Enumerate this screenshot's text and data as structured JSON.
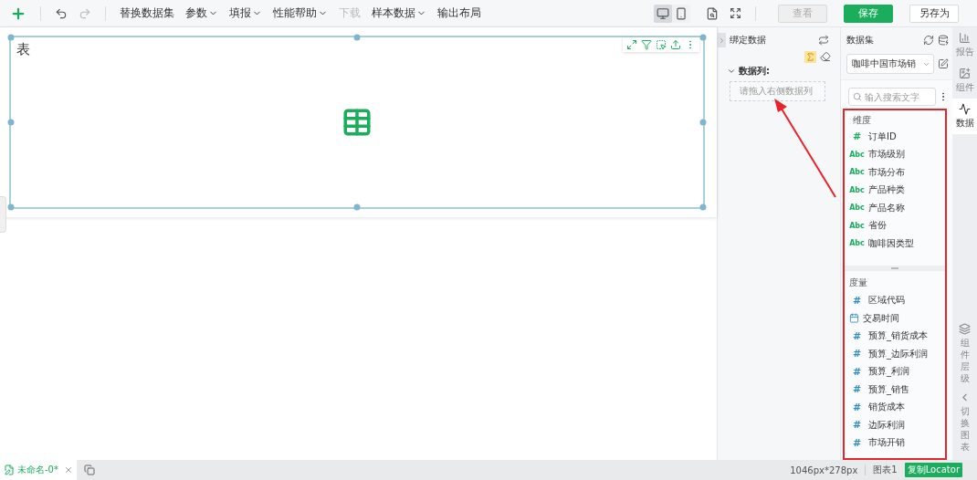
{
  "toolbar": {
    "menus": [
      {
        "label": "替换数据集",
        "dropdown": false,
        "disabled": false
      },
      {
        "label": "参数",
        "dropdown": true,
        "disabled": false
      },
      {
        "label": "填报",
        "dropdown": true,
        "disabled": false
      },
      {
        "label": "性能帮助",
        "dropdown": true,
        "disabled": false
      },
      {
        "label": "下载",
        "dropdown": false,
        "disabled": true
      },
      {
        "label": "样本数据",
        "dropdown": true,
        "disabled": false
      },
      {
        "label": "输出布局",
        "dropdown": false,
        "disabled": false
      }
    ],
    "view_modes": [
      {
        "kind": "desktop",
        "selected": true
      },
      {
        "kind": "mobile",
        "selected": false
      }
    ],
    "buttons": [
      {
        "label": "查看",
        "kind": "disabled"
      },
      {
        "label": "保存",
        "kind": "primary"
      },
      {
        "label": "另存为",
        "kind": "default"
      }
    ]
  },
  "canvas": {
    "chart_title": "表"
  },
  "bind_panel": {
    "title": "绑定数据",
    "section": {
      "label": "数据列:",
      "expanded": true
    },
    "drop_placeholder": "请拖入右侧数据列"
  },
  "dataset_panel": {
    "title": "数据集",
    "dataset": "咖啡中国市场销",
    "search": {
      "placeholder": "输入搜索文字"
    },
    "dimensions": {
      "label": "维度",
      "fields": [
        {
          "kind": "number",
          "icon": "#",
          "name": "订单ID"
        },
        {
          "kind": "text",
          "icon": "Abc",
          "name": "市场级别"
        },
        {
          "kind": "text",
          "icon": "Abc",
          "name": "市场分布"
        },
        {
          "kind": "text",
          "icon": "Abc",
          "name": "产品种类"
        },
        {
          "kind": "text",
          "icon": "Abc",
          "name": "产品名称"
        },
        {
          "kind": "text",
          "icon": "Abc",
          "name": "省份"
        },
        {
          "kind": "text",
          "icon": "Abc",
          "name": "咖啡因类型"
        }
      ]
    },
    "measures": {
      "label": "度量",
      "fields": [
        {
          "kind": "number",
          "icon": "#",
          "name": "区域代码"
        },
        {
          "kind": "date",
          "name": "交易时间"
        },
        {
          "kind": "number",
          "icon": "#",
          "name": "预算_销货成本"
        },
        {
          "kind": "number",
          "icon": "#",
          "name": "预算_边际利润"
        },
        {
          "kind": "number",
          "icon": "#",
          "name": "预算_利润"
        },
        {
          "kind": "number",
          "icon": "#",
          "name": "预算_销售"
        },
        {
          "kind": "number",
          "icon": "#",
          "name": "销货成本"
        },
        {
          "kind": "number",
          "icon": "#",
          "name": "边际利润"
        },
        {
          "kind": "number",
          "icon": "#",
          "name": "市场开销"
        }
      ]
    }
  },
  "side_tabs": [
    {
      "kind": "report",
      "label": "报告",
      "selected": false
    },
    {
      "kind": "component",
      "label": "组件",
      "selected": false
    },
    {
      "kind": "data",
      "label": "数据",
      "selected": true
    }
  ],
  "side_tools": [
    {
      "kind": "layers",
      "label": "组件层级"
    },
    {
      "kind": "switch",
      "label": "切换图表"
    }
  ],
  "status_bar": {
    "tab": "未命名-0*",
    "size": "1046px*278px",
    "component": "图表1",
    "locator_button": "复制Locator"
  }
}
